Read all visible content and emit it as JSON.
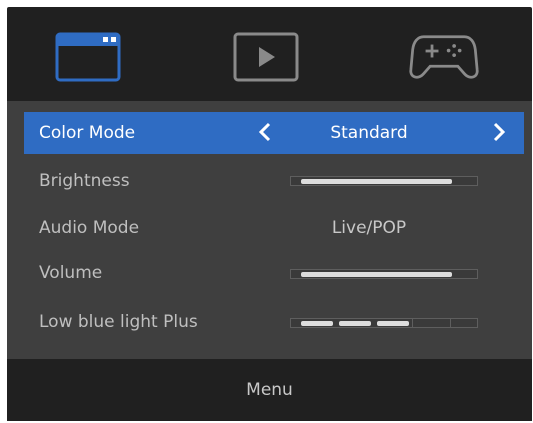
{
  "tabs": [
    {
      "name": "picture-mode-tab",
      "icon": "window-icon",
      "selected": true
    },
    {
      "name": "movie-tab",
      "icon": "play-icon",
      "selected": false
    },
    {
      "name": "game-tab",
      "icon": "gamepad-icon",
      "selected": false
    }
  ],
  "colors": {
    "accent": "#2f6cc3",
    "background": "#202020",
    "panel": "#3f3f3f"
  },
  "menu": {
    "items": [
      {
        "label": "Color Mode",
        "type": "selector",
        "value": "Standard"
      },
      {
        "label": "Brightness",
        "type": "slider",
        "level": 0.86
      },
      {
        "label": "Audio Mode",
        "type": "text",
        "value": "Live/POP"
      },
      {
        "label": "Volume",
        "type": "slider",
        "level": 0.86
      },
      {
        "label": "Low blue light Plus",
        "type": "segments",
        "level_filled": 3,
        "level_total": 5
      }
    ]
  },
  "footer": {
    "label": "Menu"
  }
}
